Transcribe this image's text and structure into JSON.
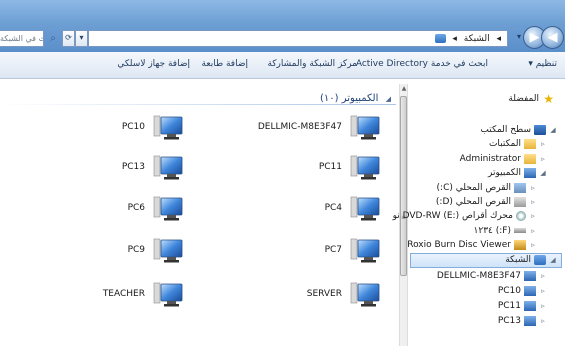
{
  "address_bar": {
    "search_placeholder": "بحث في الشبكة",
    "breadcrumbs": [
      "الشبكة"
    ],
    "refresh_label": "⟳",
    "dropdown_label": "▾"
  },
  "navigation": {
    "back_label": "◀",
    "forward_label": "▶",
    "history_label": "▾"
  },
  "toolbar": {
    "organize": "تنظيم ▾",
    "search_ad": "ابحث في خدمة Active Directory",
    "network_center": "مركز الشبكة والمشاركة",
    "add_printer": "إضافة طابعة",
    "add_wireless": "إضافة جهاز لاسلكي"
  },
  "content": {
    "group_label": "الكمبيوتر (١٠)",
    "computers": [
      {
        "name": "DELLMIC-M8E3F47",
        "col": "right"
      },
      {
        "name": "PC10",
        "col": "left"
      },
      {
        "name": "PC11",
        "col": "right"
      },
      {
        "name": "PC13",
        "col": "left"
      },
      {
        "name": "PC4",
        "col": "right"
      },
      {
        "name": "PC6",
        "col": "left"
      },
      {
        "name": "PC7",
        "col": "right"
      },
      {
        "name": "PC9",
        "col": "left"
      },
      {
        "name": "SERVER",
        "col": "right"
      },
      {
        "name": "TEACHER",
        "col": "left"
      }
    ]
  },
  "sidebar": {
    "favorites": "المفضلة",
    "desktop": "سطح المكتب",
    "libraries": "المكتبات",
    "administrator": "Administrator",
    "computer": "الكمبيوتر",
    "drive_c": "القرص المحلي (C:)",
    "drive_d": "القرص المحلي (D:)",
    "drive_e": "محرك أقراص DVD-RW (E:) نو",
    "drive_f": "(F:) ١٢٣٤",
    "roxio": "Roxio Burn Disc Viewer",
    "network": "الشبكة",
    "net_dellmic": "DELLMIC-M8E3F47",
    "net_pc10": "PC10",
    "net_pc11": "PC11",
    "net_pc13": "PC13"
  },
  "colors": {
    "accent": "#5b8fca",
    "selection": "#cfe3f8"
  }
}
